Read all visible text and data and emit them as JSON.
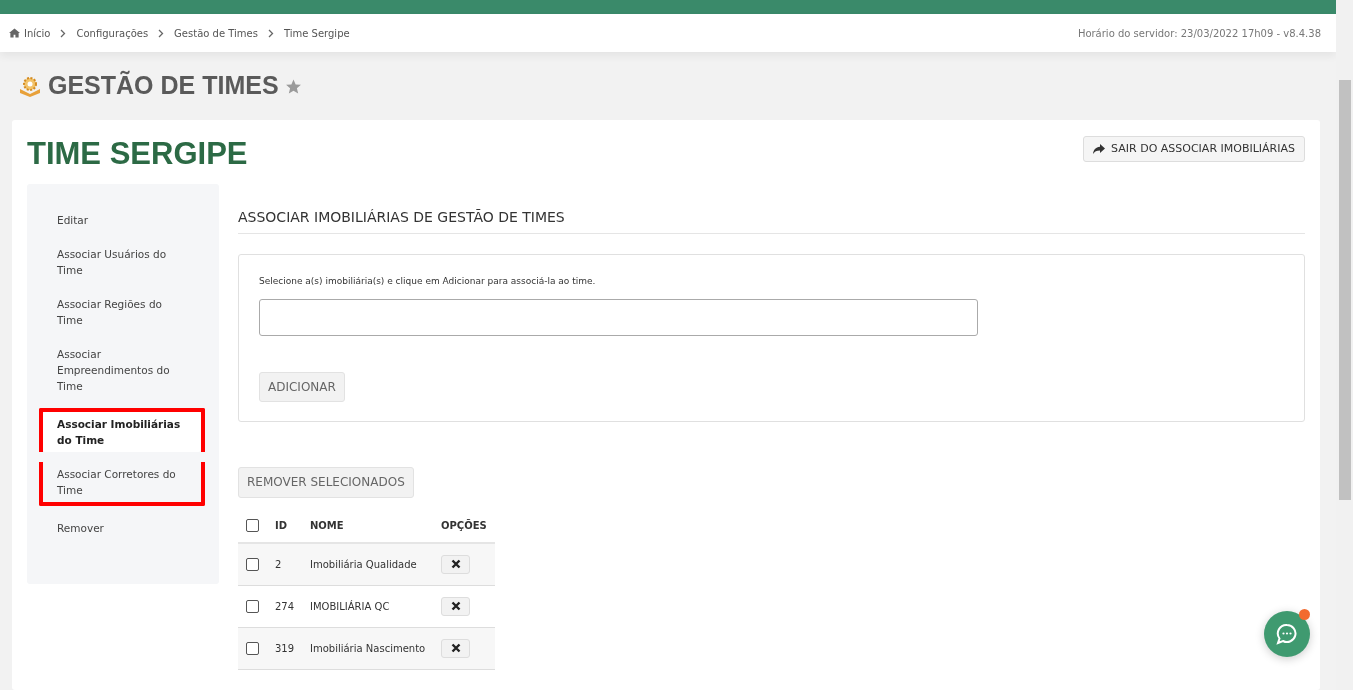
{
  "breadcrumb": [
    "Início",
    "Configurações",
    "Gestão de Times",
    "Time Sergipe"
  ],
  "server_info": "Horário do servidor: 23/03/2022 17h09 - v8.4.38",
  "page_title": "GESTÃO DE TIMES",
  "favorite": false,
  "team_title": "TIME SERGIPE",
  "exit_button": "SAIR DO ASSOCIAR IMOBILIÁRIAS",
  "sidebar": {
    "items": [
      {
        "label": "Editar",
        "selected": false,
        "highlighted": false
      },
      {
        "label": "Associar Usuários do Time",
        "selected": false,
        "highlighted": false
      },
      {
        "label": "Associar Regiões do Time",
        "selected": false,
        "highlighted": false
      },
      {
        "label": "Associar Empreendimentos do Time",
        "selected": false,
        "highlighted": false
      },
      {
        "label": "Associar Imobiliárias do Time",
        "selected": true,
        "highlighted": true
      },
      {
        "label": "Associar Corretores do Time",
        "selected": false,
        "highlighted": true
      },
      {
        "label": "Remover",
        "selected": false,
        "highlighted": false
      }
    ]
  },
  "section_title": "ASSOCIAR IMOBILIÁRIAS DE GESTÃO DE TIMES",
  "form": {
    "hint": "Selecione a(s) imobiliária(s) e clique em Adicionar para associá-la ao time.",
    "add_button": "ADICIONAR"
  },
  "remove_button": "REMOVER SELECIONADOS",
  "table": {
    "select_all": false,
    "columns": [
      "ID",
      "NOME",
      "OPÇÕES"
    ],
    "rows": [
      {
        "id": "2",
        "name": "Imobiliária Qualidade",
        "checked": false
      },
      {
        "id": "274",
        "name": "IMOBILIÁRIA QC",
        "checked": false
      },
      {
        "id": "319",
        "name": "Imobiliária Nascimento",
        "checked": false
      }
    ]
  },
  "chat": {
    "unread": true
  }
}
